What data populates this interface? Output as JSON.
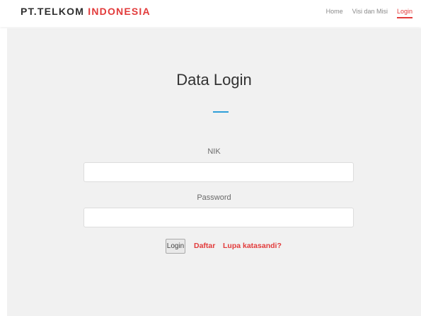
{
  "brand": {
    "part1": "PT.TELKOM",
    "part2": "INDONESIA"
  },
  "nav": {
    "home": "Home",
    "visi_misi": "Visi dan Misi",
    "login": "Login"
  },
  "form": {
    "title": "Data Login",
    "nik_label": "NIK",
    "nik_value": "",
    "password_label": "Password",
    "password_value": "",
    "login_button": "Login",
    "daftar_link": "Daftar",
    "lupa_link": "Lupa katasandi?"
  },
  "colors": {
    "accent_red": "#e23b3b",
    "divider_blue": "#2e9fd8",
    "panel_bg": "#f1f1f1"
  }
}
